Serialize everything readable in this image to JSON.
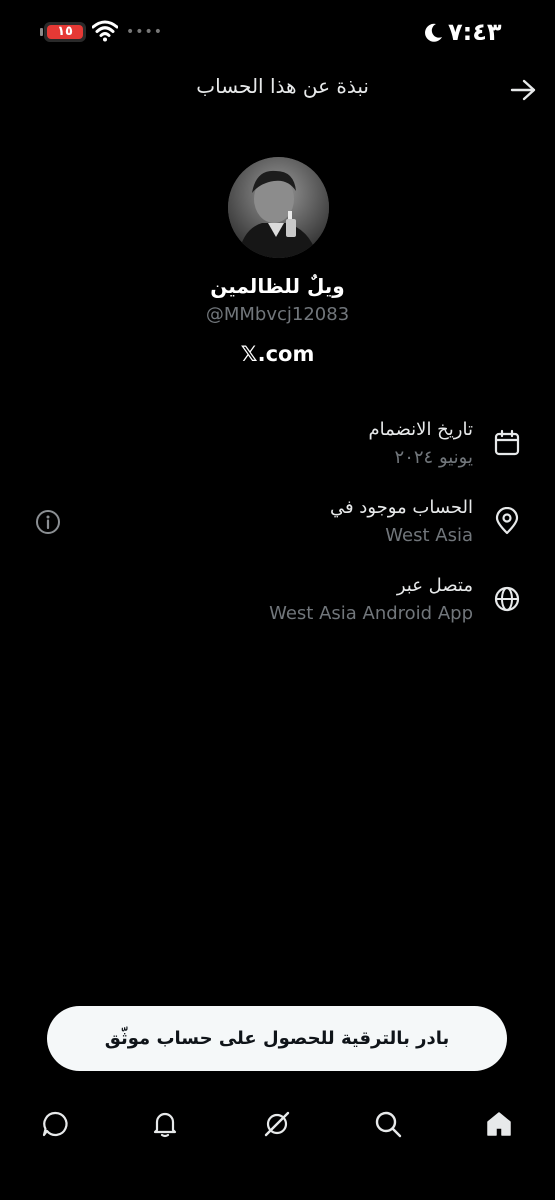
{
  "status_bar": {
    "battery": "١٥",
    "dots": "••••",
    "time": "٧:٤٣"
  },
  "header": {
    "title": "نبذة عن هذا الحساب"
  },
  "profile": {
    "display_name": "ويلٌ للظالمين",
    "username": "@MMbvcj12083",
    "website": "𝕏.com"
  },
  "info": {
    "joined_label": "تاريخ الانضمام",
    "joined_value": "يونيو ٢٠٢٤",
    "location_label": "الحساب موجود في",
    "location_value": "West Asia",
    "connected_label": "متصل عبر",
    "connected_value": "West Asia Android App"
  },
  "upgrade": {
    "label": "بادر بالترقية للحصول على حساب موثّق"
  },
  "nav": {
    "items": [
      "home-icon",
      "search-icon",
      "grok-icon",
      "bell-icon",
      "chat-icon"
    ]
  },
  "colors": {
    "background": "#000000",
    "primary_text": "#e7e9ea",
    "secondary_text": "#71767b",
    "battery_low": "#e53935"
  }
}
